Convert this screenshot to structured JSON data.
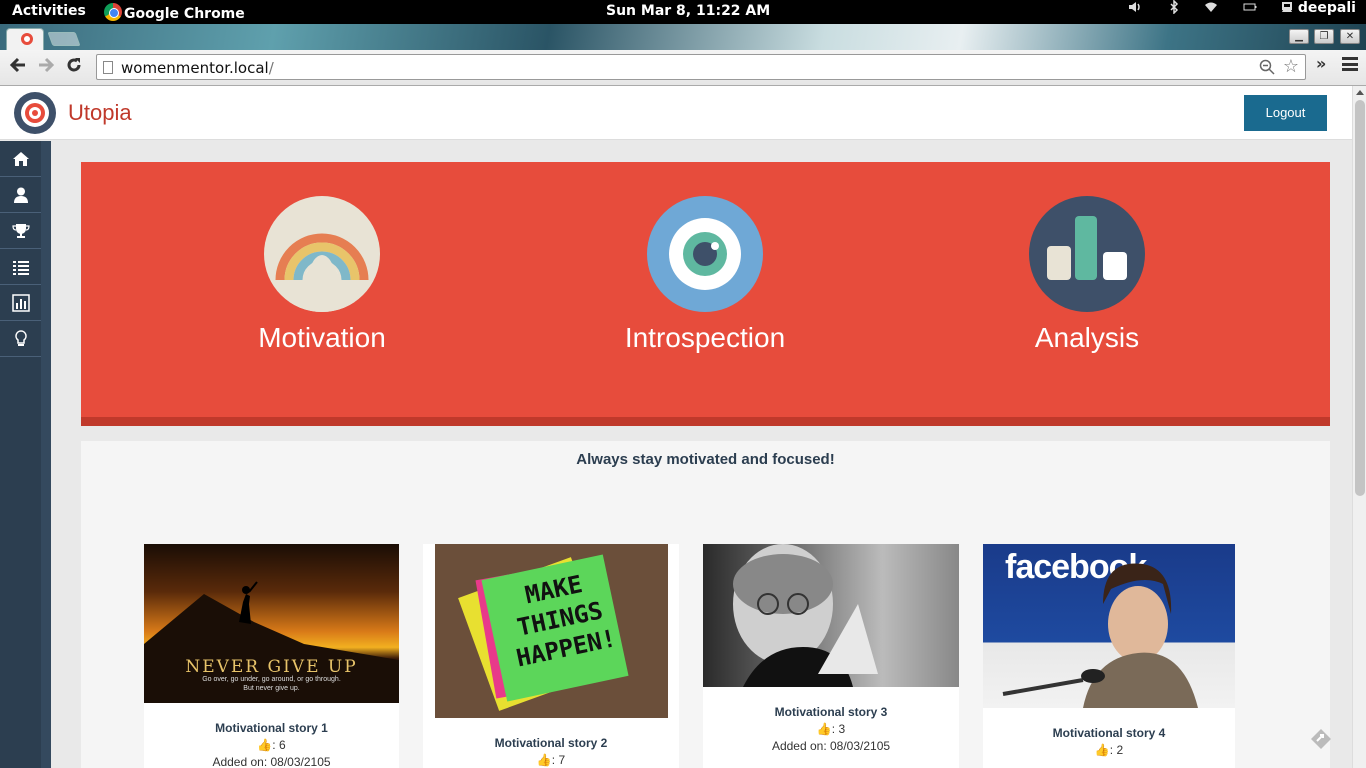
{
  "system_bar": {
    "activities": "Activities",
    "app_name": "Google Chrome",
    "clock": "Sun Mar  8, 11:22 AM",
    "user": "deepali"
  },
  "browser": {
    "url_host": "womenmentor.local",
    "url_path": "/"
  },
  "header": {
    "brand": "Utopia",
    "logout_label": "Logout"
  },
  "sidebar": {
    "items": [
      {
        "icon": "home-icon"
      },
      {
        "icon": "user-icon"
      },
      {
        "icon": "trophy-icon"
      },
      {
        "icon": "list-icon"
      },
      {
        "icon": "bar-chart-icon"
      },
      {
        "icon": "lightbulb-icon"
      }
    ]
  },
  "banner": {
    "features": [
      {
        "label": "Motivation",
        "icon": "rainbow-icon"
      },
      {
        "label": "Introspection",
        "icon": "eye-icon"
      },
      {
        "label": "Analysis",
        "icon": "bar-chart-icon"
      }
    ]
  },
  "main": {
    "tagline": "Always stay motivated and focused!",
    "stories": [
      {
        "title": "Motivational story 1",
        "likes": ": 6",
        "added": "Added on: 08/03/2105",
        "image_text": "NEVER GIVE UP",
        "image_subtext_1": "Go over, go under, go around, or go through.",
        "image_subtext_2": "But never give up."
      },
      {
        "title": "Motivational story 2",
        "likes": ": 7",
        "image_text_1": "MAKE",
        "image_text_2": "THINGS",
        "image_text_3": "HAPPEN!"
      },
      {
        "title": "Motivational story 3",
        "likes": ": 3",
        "added": "Added on: 08/03/2105"
      },
      {
        "title": "Motivational story 4",
        "likes": ": 2",
        "image_text": "facebook"
      }
    ]
  },
  "colors": {
    "accent": "#e74c3c",
    "accent_dark": "#c0392b",
    "sidebar": "#2c3e50",
    "logout": "#1a6a8f"
  }
}
